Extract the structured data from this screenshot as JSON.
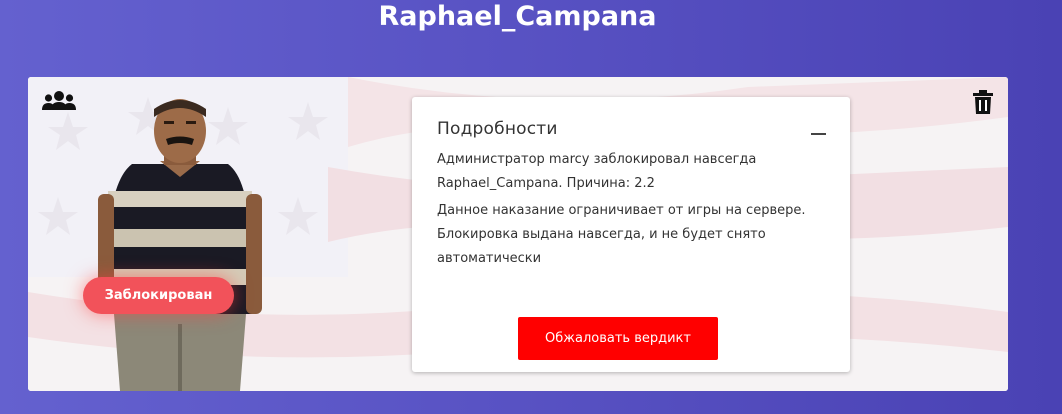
{
  "header": {
    "player_name": "Raphael_Campana"
  },
  "card": {
    "status_badge": "Заблокирован",
    "details": {
      "title": "Подробности",
      "text_1": "Администратор marcy заблокировал навсегда Raphael_Campana. Причина: 2.2",
      "text_2": "Данное наказание ограничивает от игры на сервере. Блокировка выдана навсегда, и не будет снято автоматически",
      "appeal_button": "Обжаловать вердикт"
    },
    "icons": [
      "users-group-icon",
      "trash-icon",
      "collapse-icon"
    ]
  },
  "colors": {
    "background_left": "#6461cf",
    "background_right": "#4a42b4",
    "badge": "#f2525a",
    "button": "#ff0000"
  }
}
